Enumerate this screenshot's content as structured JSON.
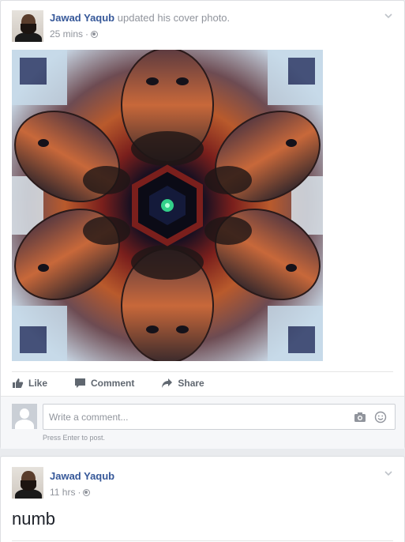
{
  "post1": {
    "author": "Jawad Yaqub",
    "action_text": "updated his cover photo.",
    "timestamp": "25 mins",
    "separator": "·",
    "privacy_icon": "globe-icon",
    "actions": {
      "like_label": "Like",
      "comment_label": "Comment",
      "share_label": "Share"
    },
    "comment": {
      "placeholder": "Write a comment...",
      "hint": "Press Enter to post.",
      "camera_icon": "camera-icon",
      "emoji_icon": "emoji-icon"
    }
  },
  "post2": {
    "author": "Jawad Yaqub",
    "timestamp": "11 hrs",
    "separator": "·",
    "privacy_icon": "globe-icon",
    "status_text": "numb"
  },
  "colors": {
    "link_blue": "#365899",
    "meta_gray": "#90949c",
    "page_bg": "#e9ebee"
  }
}
